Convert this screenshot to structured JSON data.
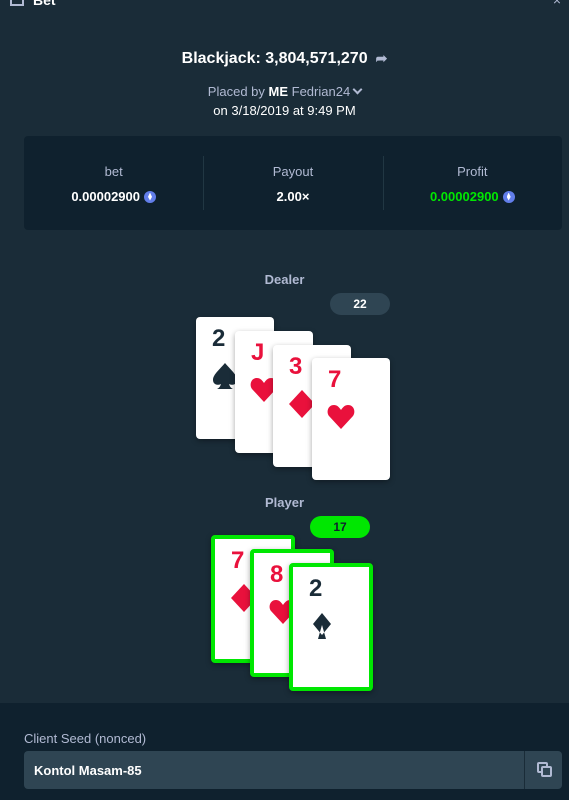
{
  "window": {
    "title": "Bet"
  },
  "header": {
    "game": "Blackjack: 3,804,571,270",
    "placed_by_prefix": "Placed by",
    "rank_tag": "ME",
    "username": "Fedrian24",
    "date": "on 3/18/2019 at 9:49 PM"
  },
  "stats": {
    "bet_label": "bet",
    "bet_value": "0.00002900",
    "payout_label": "Payout",
    "payout_value": "2.00×",
    "profit_label": "Profit",
    "profit_value": "0.00002900"
  },
  "dealer": {
    "label": "Dealer",
    "total": "22",
    "cards": [
      {
        "rank": "2",
        "suit": "spade",
        "color": "black"
      },
      {
        "rank": "J",
        "suit": "heart",
        "color": "red"
      },
      {
        "rank": "3",
        "suit": "diamond",
        "color": "red"
      },
      {
        "rank": "7",
        "suit": "heart",
        "color": "red"
      }
    ]
  },
  "player": {
    "label": "Player",
    "total": "17",
    "cards": [
      {
        "rank": "7",
        "suit": "diamond",
        "color": "red"
      },
      {
        "rank": "8",
        "suit": "heart",
        "color": "red"
      },
      {
        "rank": "2",
        "suit": "club",
        "color": "black"
      }
    ]
  },
  "seed": {
    "label": "Client Seed (nonced)",
    "value": "Kontol Masam-85"
  },
  "colors": {
    "win": "#00e701",
    "red_suit": "#e9113c",
    "background": "#1a2c38",
    "panel": "#0f212e"
  }
}
